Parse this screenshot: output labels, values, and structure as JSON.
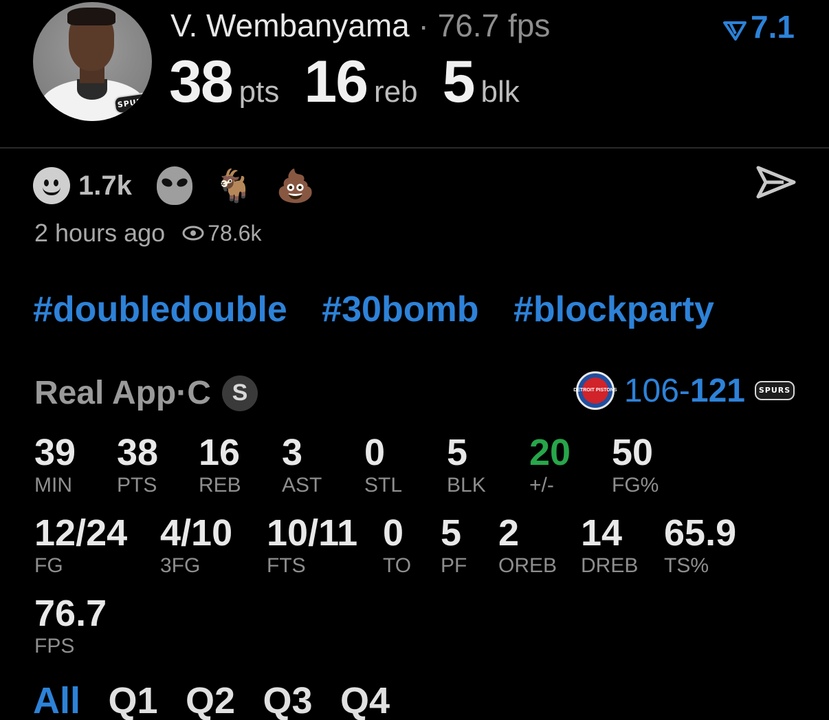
{
  "header": {
    "player_name": "V. Wembanyama",
    "separator": " · ",
    "fps_text": "76.7 fps",
    "rating": "7.1",
    "team_logo_text": "SPURS",
    "headline_stats": [
      {
        "value": "38",
        "unit": "pts"
      },
      {
        "value": "16",
        "unit": "reb"
      },
      {
        "value": "5",
        "unit": "blk"
      }
    ]
  },
  "reactions": {
    "count": "1.7k",
    "icons": [
      "smile-icon",
      "alien-icon",
      "goat-icon",
      "poop-icon"
    ],
    "goat_glyph": "🐐",
    "poop_glyph": "💩"
  },
  "meta": {
    "time_ago": "2 hours ago",
    "views": "78.6k"
  },
  "hashtags": [
    "#doubledouble",
    "#30bomb",
    "#blockparty"
  ],
  "game": {
    "source": "Real App",
    "position_sep": " · ",
    "position": "C",
    "badge": "S",
    "opponent_logo_text": "DETROIT PISTONS",
    "score_away": "106",
    "score_dash": "-",
    "score_home": "121",
    "home_logo_text": "SPURS"
  },
  "stats_row1": [
    {
      "value": "39",
      "label": "MIN"
    },
    {
      "value": "38",
      "label": "PTS"
    },
    {
      "value": "16",
      "label": "REB"
    },
    {
      "value": "3",
      "label": "AST"
    },
    {
      "value": "0",
      "label": "STL"
    },
    {
      "value": "5",
      "label": "BLK"
    },
    {
      "value": "20",
      "label": "+/-"
    },
    {
      "value": "50",
      "label": "FG%"
    }
  ],
  "stats_row2": [
    {
      "value": "12/24",
      "label": "FG"
    },
    {
      "value": "4/10",
      "label": "3FG"
    },
    {
      "value": "10/11",
      "label": "FTS"
    },
    {
      "value": "0",
      "label": "TO"
    },
    {
      "value": "5",
      "label": "PF"
    },
    {
      "value": "2",
      "label": "OREB"
    },
    {
      "value": "14",
      "label": "DREB"
    },
    {
      "value": "65.9",
      "label": "TS%"
    }
  ],
  "stats_row3": [
    {
      "value": "76.7",
      "label": "FPS"
    }
  ],
  "tabs": [
    "All",
    "Q1",
    "Q2",
    "Q3",
    "Q4"
  ],
  "colors": {
    "accent": "#2d82d8",
    "positive": "#27a64a",
    "background": "#000000"
  }
}
